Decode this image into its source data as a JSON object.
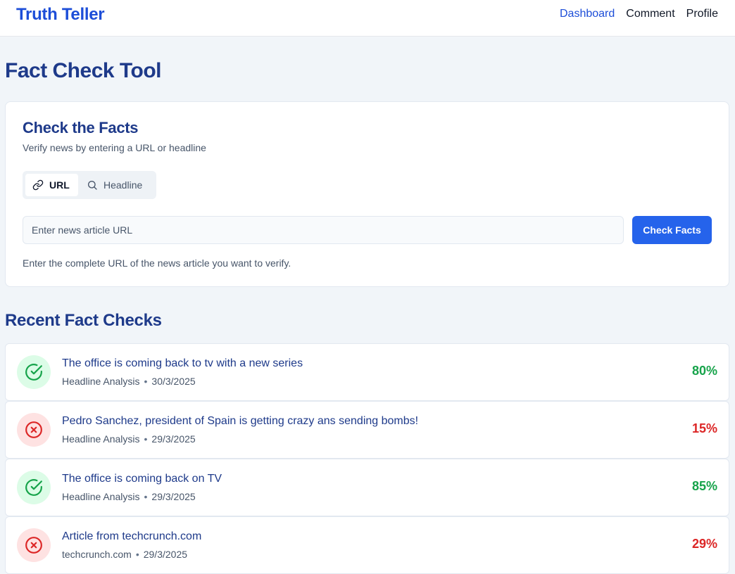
{
  "brand": "Truth Teller",
  "nav": [
    {
      "label": "Dashboard",
      "active": true
    },
    {
      "label": "Comment",
      "active": false
    },
    {
      "label": "Profile",
      "active": false
    }
  ],
  "page_title": "Fact Check Tool",
  "check_card": {
    "title": "Check the Facts",
    "subtitle": "Verify news by entering a URL or headline",
    "tabs": [
      {
        "label": "URL",
        "icon": "link-icon",
        "active": true
      },
      {
        "label": "Headline",
        "icon": "search-icon",
        "active": false
      }
    ],
    "input_placeholder": "Enter news article URL",
    "input_value": "",
    "button_label": "Check Facts",
    "helper_text": "Enter the complete URL of the news article you want to verify."
  },
  "recent": {
    "title": "Recent Fact Checks",
    "items": [
      {
        "title": "The office is coming back to tv with a new series",
        "source": "Headline Analysis",
        "date": "30/3/2025",
        "score": "80%",
        "status": "pass"
      },
      {
        "title": "Pedro Sanchez, president of Spain is getting crazy ans sending bombs!",
        "source": "Headline Analysis",
        "date": "29/3/2025",
        "score": "15%",
        "status": "fail"
      },
      {
        "title": "The office is coming back on TV",
        "source": "Headline Analysis",
        "date": "29/3/2025",
        "score": "85%",
        "status": "pass"
      },
      {
        "title": "Article from techcrunch.com",
        "source": "techcrunch.com",
        "date": "29/3/2025",
        "score": "29%",
        "status": "fail"
      }
    ]
  },
  "colors": {
    "accent": "#2563eb",
    "pass": "#16a34a",
    "fail": "#dc2626",
    "heading": "#1e3a8a"
  },
  "icons": {
    "pass": "check-circle-icon",
    "fail": "x-circle-icon"
  }
}
